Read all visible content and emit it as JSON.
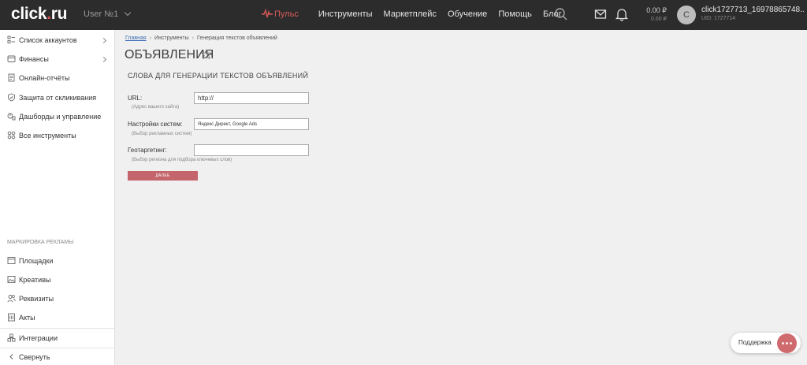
{
  "topbar": {
    "logo_main": "click",
    "logo_dot": ".",
    "logo_tld": "ru",
    "user_selector": "User №1",
    "nav": [
      "Пульс",
      "Инструменты",
      "Маркетплейс",
      "Обучение",
      "Помощь",
      "Блог"
    ],
    "balance_main": "0.00 ₽",
    "balance_sub": "0.00 ₽",
    "avatar_letter": "C",
    "account_name": "click1727713_16978865748...",
    "account_uid": "UID: 1727714"
  },
  "sidebar": {
    "items": [
      {
        "label": "Список аккаунтов",
        "icon": "accounts-list-icon"
      },
      {
        "label": "Финансы",
        "icon": "wallet-icon"
      },
      {
        "label": "Онлайн-отчёты",
        "icon": "report-icon"
      },
      {
        "label": "Защита от скликивания",
        "icon": "shield-icon"
      },
      {
        "label": "Дашборды и управление",
        "icon": "dashboard-icon"
      },
      {
        "label": "Все инструменты",
        "icon": "tools-icon"
      }
    ],
    "section_title": "МАРКИРОВКА РЕКЛАМЫ",
    "marking_items": [
      {
        "label": "Площадки",
        "icon": "window-icon"
      },
      {
        "label": "Креативы",
        "icon": "image-icon"
      },
      {
        "label": "Реквизиты",
        "icon": "users-icon"
      },
      {
        "label": "Акты",
        "icon": "document-icon"
      }
    ],
    "integrations": "Интеграции",
    "collapse": "Свернуть"
  },
  "breadcrumbs": {
    "home": "Главная",
    "tools": "Инструменты",
    "current": "Генерация текстов объявлений"
  },
  "page": {
    "title": "ОБЪЯВЛЕНИЯ",
    "section_title": "СЛОВА ДЛЯ ГЕНЕРАЦИИ ТЕКСТОВ ОБЪЯВЛЕНИЙ"
  },
  "form": {
    "url_label": "URL:",
    "url_hint": "(Адрес вашего сайта)",
    "url_value": "http://",
    "systems_label": "Настройки систем:",
    "systems_hint": "(Выбор рекламных систем)",
    "systems_value": "Яндекс Директ, Google Ads",
    "geo_label": "Геотаргетинг:",
    "geo_hint": "(Выбор региона для подбора ключевых слов)",
    "geo_value": "",
    "next_button": "ДАЛЕЕ"
  },
  "support": {
    "label": "Поддержка"
  },
  "colors": {
    "topbar_bg": "#2c2c2c",
    "accent": "#d85a5a",
    "button": "#c4656b"
  }
}
